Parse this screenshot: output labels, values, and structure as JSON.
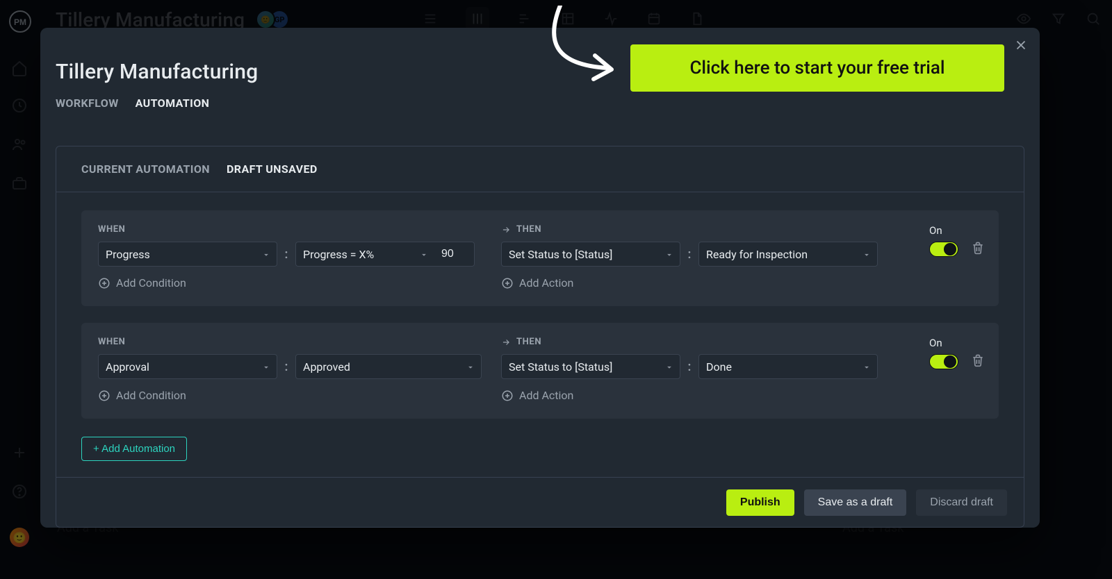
{
  "app": {
    "title": "Tillery Manufacturing",
    "avatar2": "GP"
  },
  "rail": {
    "add": "+",
    "help": "?"
  },
  "cta_label": "Click here to start your free trial",
  "dialog": {
    "title": "Tillery Manufacturing",
    "tabs": {
      "workflow": "WORKFLOW",
      "automation": "AUTOMATION"
    }
  },
  "panel": {
    "tabs": {
      "current": "CURRENT AUTOMATION",
      "draft": "DRAFT UNSAVED"
    },
    "when_label": "WHEN",
    "then_label": "THEN",
    "add_condition": "Add Condition",
    "add_action": "Add Action",
    "add_automation": "+ Add Automation",
    "on_label": "On",
    "rules": [
      {
        "when_field": "Progress",
        "when_op": "Progress = X%",
        "when_value": "90",
        "then_action": "Set Status to [Status]",
        "then_value": "Ready for Inspection"
      },
      {
        "when_field": "Approval",
        "when_op": "Approved",
        "when_value": "",
        "then_action": "Set Status to [Status]",
        "then_value": "Done"
      }
    ]
  },
  "footer": {
    "publish": "Publish",
    "save_draft": "Save as a draft",
    "discard": "Discard draft"
  },
  "ghost_task": "Add a Task"
}
